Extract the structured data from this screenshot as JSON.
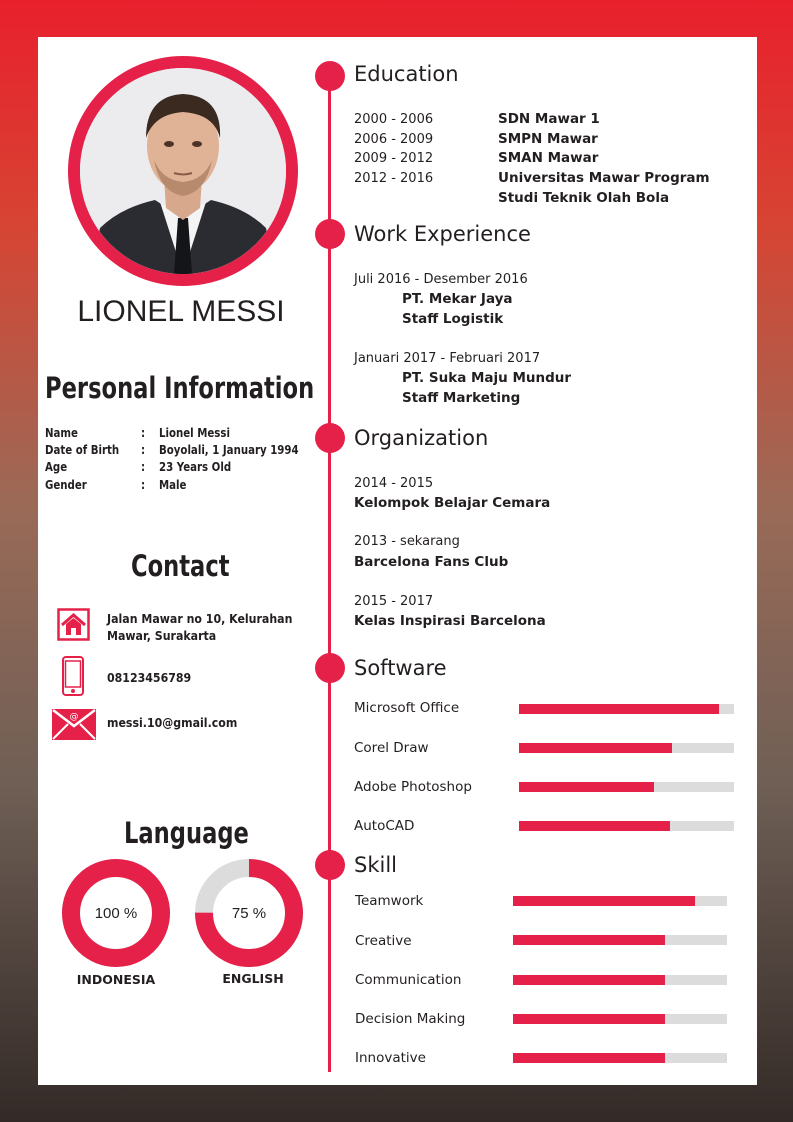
{
  "profile": {
    "name": "LIONEL MESSI"
  },
  "personal_info": {
    "heading": "Personal Information",
    "rows": [
      {
        "label": "Name",
        "value": "Lionel Messi"
      },
      {
        "label": "Date  of Birth",
        "value": "Boyolali, 1 January 1994"
      },
      {
        "label": "Age",
        "value": "23 Years Old"
      },
      {
        "label": "Gender",
        "value": "Male"
      }
    ],
    "separator": ":"
  },
  "contact": {
    "heading": "Contact",
    "address_line1": "Jalan Mawar no 10, Kelurahan",
    "address_line2": "Mawar, Surakarta",
    "phone": "08123456789",
    "email": "messi.10@gmail.com",
    "icons": [
      "home-icon",
      "phone-icon",
      "mail-icon"
    ],
    "icon_color": "#e5214a"
  },
  "language": {
    "heading": "Language",
    "items": [
      {
        "name": "INDONESIA",
        "percent_label": "100 %",
        "level": 1.0
      },
      {
        "name": "ENGLISH",
        "percent_label": "75 %",
        "level": 0.75
      }
    ]
  },
  "education": {
    "heading": "Education",
    "rows": [
      {
        "years": "2000 - 2006",
        "school": "SDN Mawar 1"
      },
      {
        "years": "2006 - 2009",
        "school": "SMPN Mawar"
      },
      {
        "years": "2009 - 2012",
        "school": "SMAN Mawar"
      },
      {
        "years": "2012 - 2016",
        "school": "Universitas Mawar Program",
        "school_line2": "Studi Teknik Olah Bola"
      }
    ]
  },
  "work": {
    "heading": "Work Experience",
    "items": [
      {
        "period": "Juli 2016 - Desember 2016",
        "company": "PT. Mekar Jaya",
        "role": "Staff Logistik"
      },
      {
        "period": "Januari 2017 - Februari 2017",
        "company": "PT. Suka Maju Mundur",
        "role": "Staff Marketing"
      }
    ]
  },
  "organization": {
    "heading": "Organization",
    "items": [
      {
        "period": "2014 - 2015",
        "name": "Kelompok Belajar Cemara"
      },
      {
        "period": "2013 - sekarang",
        "name": "Barcelona Fans Club"
      },
      {
        "period": "2015 - 2017",
        "name": "Kelas Inspirasi Barcelona"
      }
    ]
  },
  "software": {
    "heading": "Software",
    "items": [
      {
        "name": "Microsoft Office",
        "level": 0.93
      },
      {
        "name": "Corel Draw",
        "level": 0.71
      },
      {
        "name": "Adobe Photoshop",
        "level": 0.63
      },
      {
        "name": "AutoCAD",
        "level": 0.7
      }
    ]
  },
  "skill": {
    "heading": "Skill",
    "items": [
      {
        "name": "Teamwork",
        "level": 0.85
      },
      {
        "name": "Creative",
        "level": 0.71
      },
      {
        "name": "Communication",
        "level": 0.71
      },
      {
        "name": "Decision Making",
        "level": 0.71
      },
      {
        "name": "Innovative",
        "level": 0.71
      }
    ]
  },
  "colors": {
    "accent": "#e5214a",
    "track": "#dcdcdc",
    "text": "#231f20"
  }
}
